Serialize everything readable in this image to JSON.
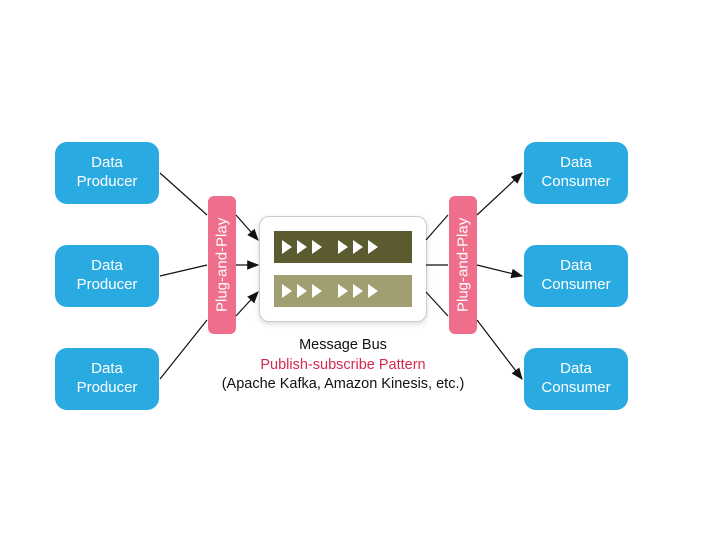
{
  "producers": [
    {
      "label": "Data\nProducer"
    },
    {
      "label": "Data\nProducer"
    },
    {
      "label": "Data\nProducer"
    }
  ],
  "consumers": [
    {
      "label": "Data\nConsumer"
    },
    {
      "label": "Data\nConsumer"
    },
    {
      "label": "Data\nConsumer"
    }
  ],
  "plug_left": {
    "label": "Plug-and-Play"
  },
  "plug_right": {
    "label": "Plug-and-Play"
  },
  "bus_caption": {
    "line1": "Message Bus",
    "line2": "Publish-subscribe Pattern",
    "line3": "(Apache Kafka, Amazon Kinesis, etc.)"
  }
}
